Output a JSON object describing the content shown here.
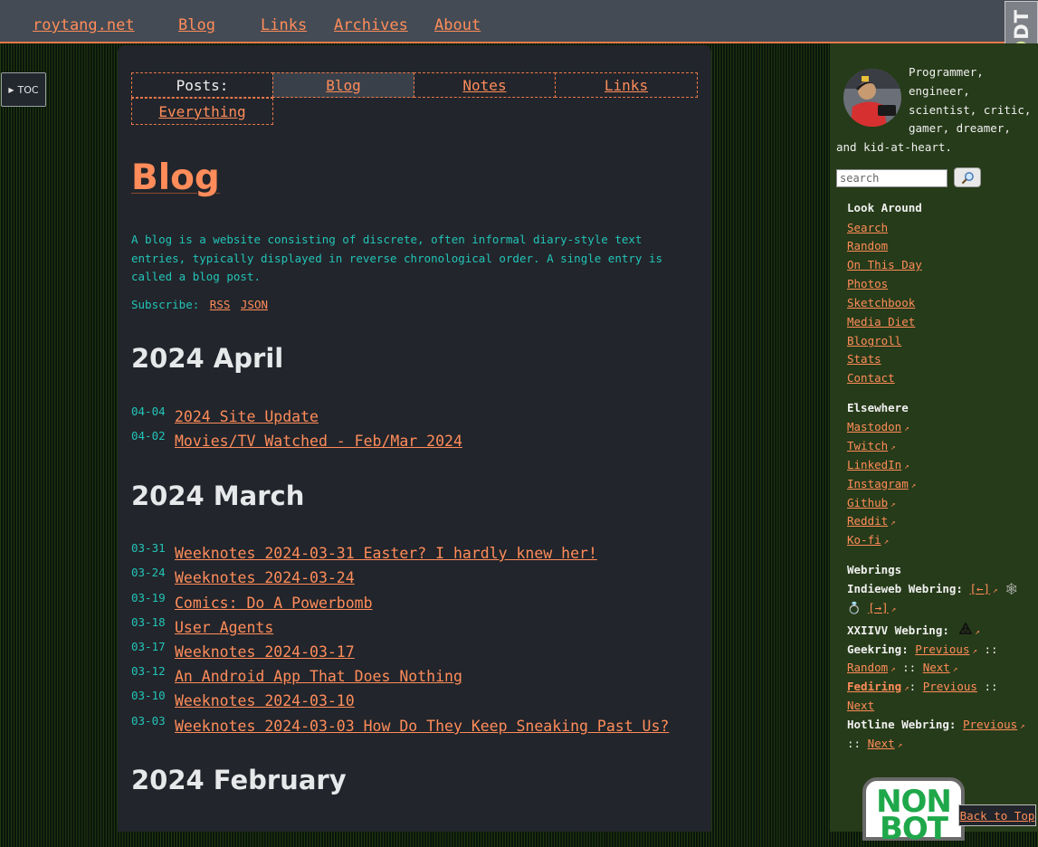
{
  "header": {
    "site_name": "roytang.net",
    "nav": [
      "Blog",
      "Links",
      "Archives",
      "About"
    ],
    "badge_text": "DDT"
  },
  "toc": {
    "label": "TOC"
  },
  "posts_nav": {
    "label": "Posts:",
    "items": [
      "Blog",
      "Notes",
      "Links",
      "Everything"
    ],
    "active": "Blog"
  },
  "page": {
    "title": "Blog",
    "description": "A blog is a website consisting of discrete, often informal diary-style text entries, typically displayed in reverse chronological order. A single entry is called a blog post.",
    "subscribe_label": "Subscribe:",
    "subscribe_links": [
      "RSS",
      "JSON"
    ]
  },
  "months": [
    {
      "title": "2024 April",
      "posts": [
        {
          "date": "04-04",
          "title": "2024 Site Update"
        },
        {
          "date": "04-02",
          "title": "Movies/TV Watched - Feb/Mar 2024"
        }
      ]
    },
    {
      "title": "2024 March",
      "posts": [
        {
          "date": "03-31",
          "title": "Weeknotes 2024-03-31 Easter? I hardly knew her!"
        },
        {
          "date": "03-24",
          "title": "Weeknotes 2024-03-24"
        },
        {
          "date": "03-19",
          "title": "Comics: Do A Powerbomb"
        },
        {
          "date": "03-18",
          "title": "User Agents"
        },
        {
          "date": "03-17",
          "title": "Weeknotes 2024-03-17"
        },
        {
          "date": "03-12",
          "title": "An Android App That Does Nothing"
        },
        {
          "date": "03-10",
          "title": "Weeknotes 2024-03-10"
        },
        {
          "date": "03-03",
          "title": "Weeknotes 2024-03-03 How Do They Keep Sneaking Past Us?"
        }
      ]
    },
    {
      "title": "2024 February",
      "posts": []
    }
  ],
  "sidebar": {
    "bio": "Programmer, engineer, scientist, critic, gamer, dreamer, and kid-at-heart.",
    "search_placeholder": "search",
    "look_around": {
      "title": "Look Around",
      "links": [
        "Search",
        "Random",
        "On This Day",
        "Photos",
        "Sketchbook",
        "Media Diet",
        "Blogroll",
        "Stats",
        "Contact"
      ]
    },
    "elsewhere": {
      "title": "Elsewhere",
      "links": [
        "Mastodon",
        "Twitch",
        "LinkedIn",
        "Instagram",
        "Github",
        "Reddit",
        "Ko-fi"
      ]
    },
    "webrings": {
      "title": "Webrings",
      "indieweb_label": "Indieweb Webring:",
      "indieweb_prev": "[←]",
      "indieweb_next": "[→]",
      "xxiivv_label": "XXIIVV Webring:",
      "geekring_label": "Geekring:",
      "geekring_prev": "Previous",
      "geekring_random": "Random",
      "geekring_next": "Next",
      "fediring_label": "Fediring",
      "fediring_prev": "Previous",
      "fediring_next": "Next",
      "hotline_label": "Hotline Webring:",
      "hotline_prev": "Previous",
      "hotline_next": "Next",
      "separator": "::"
    },
    "badge_line1": "NON",
    "badge_line2": "BOT"
  },
  "back_to_top": "Back to Top",
  "colors": {
    "accent": "#ff8c5a",
    "teal": "#22c4b8",
    "main_bg": "#22252b",
    "sidebar_bg": "#263b19",
    "topbar_bg": "#444b54"
  }
}
